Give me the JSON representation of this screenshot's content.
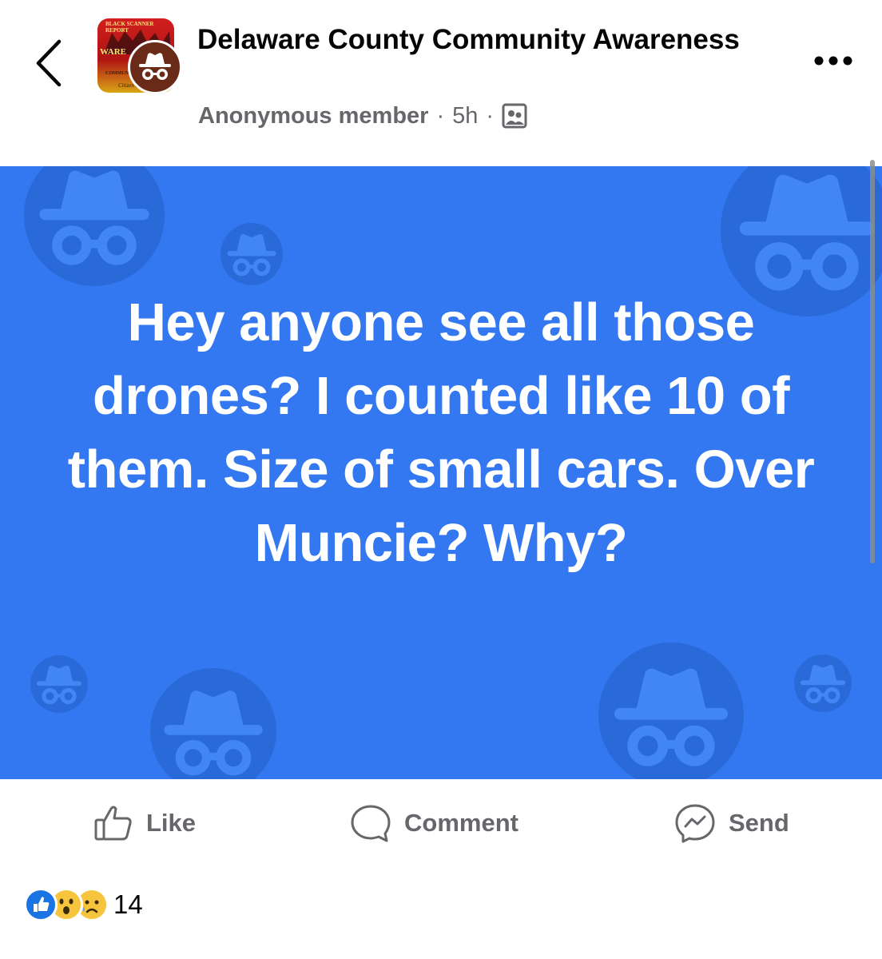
{
  "header": {
    "group_name": "Delaware County Community Awareness",
    "author": "Anonymous member",
    "time": "5h",
    "separator": "·",
    "avatar_text": {
      "top": "BLACK SCANNER REPORT",
      "ware": "WARE",
      "community": "COMMUNITY",
      "citizen": "Citizen Hea"
    }
  },
  "post": {
    "text": "Hey anyone see all those drones?  I counted like 10 of them. Size of small cars. Over Muncie? Why?",
    "background_color": "#3478f1",
    "icon": "anonymous-incognito-icon"
  },
  "actions": {
    "like": "Like",
    "comment": "Comment",
    "send": "Send"
  },
  "reactions": {
    "types": [
      "like",
      "wow",
      "sad"
    ],
    "count": "14"
  },
  "colors": {
    "text_primary": "#050505",
    "text_secondary": "#65676b",
    "like_blue": "#1b74e4",
    "reaction_yellow": "#f7c43d"
  }
}
